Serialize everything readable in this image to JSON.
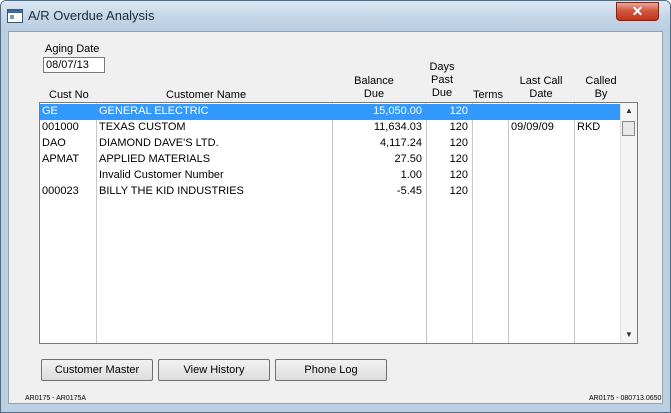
{
  "window": {
    "title": "A/R Overdue Analysis",
    "close_glyph": "✕"
  },
  "aging": {
    "label": "Aging Date",
    "value": "08/07/13"
  },
  "columns": {
    "cust_no": "Cust No",
    "customer_name": "Customer Name",
    "balance_due_1": "Balance",
    "balance_due_2": "Due",
    "days_past_due_1": "Days",
    "days_past_due_2": "Past",
    "days_past_due_3": "Due",
    "terms": "Terms",
    "last_call_1": "Last Call",
    "last_call_2": "Date",
    "called_by_1": "Called",
    "called_by_2": "By"
  },
  "rows": [
    {
      "cust_no": "GE",
      "name": "GENERAL ELECTRIC",
      "balance": "15,050.00",
      "days": "120",
      "terms": "",
      "last_call": "",
      "called_by": "",
      "selected": true
    },
    {
      "cust_no": "001000",
      "name": "TEXAS CUSTOM",
      "balance": "11,634.03",
      "days": "120",
      "terms": "",
      "last_call": "09/09/09",
      "called_by": "RKD",
      "selected": false
    },
    {
      "cust_no": "DAO",
      "name": "DIAMOND DAVE'S LTD.",
      "balance": "4,117.24",
      "days": "120",
      "terms": "",
      "last_call": "",
      "called_by": "",
      "selected": false
    },
    {
      "cust_no": "APMAT",
      "name": "APPLIED MATERIALS",
      "balance": "27.50",
      "days": "120",
      "terms": "",
      "last_call": "",
      "called_by": "",
      "selected": false
    },
    {
      "cust_no": "",
      "name": "Invalid Customer Number",
      "balance": "1.00",
      "days": "120",
      "terms": "",
      "last_call": "",
      "called_by": "",
      "selected": false
    },
    {
      "cust_no": "000023",
      "name": "BILLY THE KID INDUSTRIES",
      "balance": "-5.45",
      "days": "120",
      "terms": "",
      "last_call": "",
      "called_by": "",
      "selected": false
    }
  ],
  "scrollbar": {
    "up_glyph": "▲",
    "down_glyph": "▼"
  },
  "buttons": {
    "customer_master": "Customer Master",
    "view_history": "View History",
    "phone_log": "Phone Log"
  },
  "footer": {
    "left": "AR0175 - AR0175A",
    "right": "AR0175 - 080713.0650"
  },
  "colors": {
    "selection": "#3399ff",
    "title_bar": "#c4d6e8",
    "close_button": "#c1351e"
  }
}
